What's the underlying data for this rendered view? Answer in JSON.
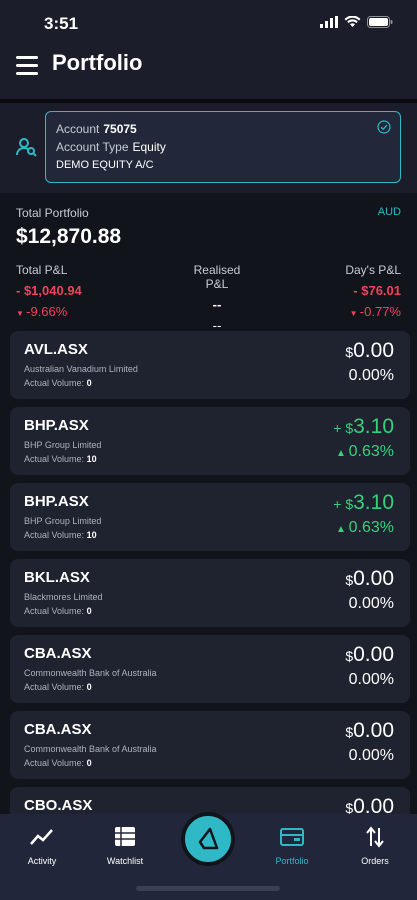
{
  "status": {
    "time": "3:51"
  },
  "header": {
    "title": "Portfolio"
  },
  "account": {
    "account_label": "Account",
    "account_number": "75075",
    "type_label": "Account Type",
    "type_value": "Equity",
    "name": "DEMO EQUITY A/C"
  },
  "summary": {
    "total_label": "Total Portfolio",
    "currency": "AUD",
    "total_value": "$12,870.88",
    "total_pl_label": "Total P&L",
    "total_pl_value": "- $1,040.94",
    "total_pl_pct": "-9.66%",
    "realised_label": "Realised P&L",
    "realised_value": "--",
    "realised_sub": "--",
    "day_label": "Day's P&L",
    "day_value": "- $76.01",
    "day_pct": "-0.77%"
  },
  "volume_label": "Actual Volume:",
  "holdings": [
    {
      "symbol": "AVL.ASX",
      "name": "Australian Vanadium Limited",
      "volume": "0",
      "price": "0.00",
      "prefix": "$",
      "pct": "0.00%",
      "trend": "flat"
    },
    {
      "symbol": "BHP.ASX",
      "name": "BHP Group Limited",
      "volume": "10",
      "price": "3.10",
      "prefix": "+ $",
      "pct": "0.63%",
      "trend": "up"
    },
    {
      "symbol": "BHP.ASX",
      "name": "BHP Group Limited",
      "volume": "10",
      "price": "3.10",
      "prefix": "+ $",
      "pct": "0.63%",
      "trend": "up"
    },
    {
      "symbol": "BKL.ASX",
      "name": "Blackmores Limited",
      "volume": "0",
      "price": "0.00",
      "prefix": "$",
      "pct": "0.00%",
      "trend": "flat"
    },
    {
      "symbol": "CBA.ASX",
      "name": "Commonwealth Bank of Australia",
      "volume": "0",
      "price": "0.00",
      "prefix": "$",
      "pct": "0.00%",
      "trend": "flat"
    },
    {
      "symbol": "CBA.ASX",
      "name": "Commonwealth Bank of Australia",
      "volume": "0",
      "price": "0.00",
      "prefix": "$",
      "pct": "0.00%",
      "trend": "flat"
    },
    {
      "symbol": "CBO.ASX",
      "name": "",
      "volume": "",
      "price": "0.00",
      "prefix": "$",
      "pct": "",
      "trend": "flat"
    }
  ],
  "nav": {
    "activity": "Activity",
    "watchlist": "Watchlist",
    "portfolio": "Portfolio",
    "orders": "Orders"
  },
  "colors": {
    "accent": "#2fb9c7",
    "positive": "#35d27a",
    "negative": "#f0435a",
    "background": "#12141c"
  }
}
